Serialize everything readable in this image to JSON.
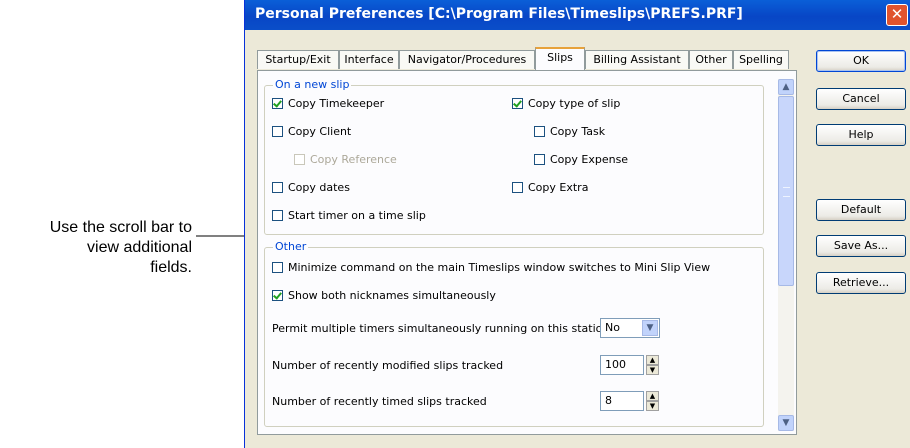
{
  "annotation": {
    "lines": [
      "Use the scroll bar to",
      "view additional",
      "fields."
    ]
  },
  "window": {
    "title": "Personal Preferences [C:\\Program Files\\Timeslips\\PREFS.PRF]",
    "close_glyph": "✕"
  },
  "tabs": [
    {
      "label": "Startup/Exit",
      "active": false
    },
    {
      "label": "Interface",
      "active": false
    },
    {
      "label": "Navigator/Procedures",
      "active": false
    },
    {
      "label": "Slips",
      "active": true
    },
    {
      "label": "Billing Assistant",
      "active": false
    },
    {
      "label": "Other",
      "active": false
    },
    {
      "label": "Spelling",
      "active": false
    }
  ],
  "new_slip_group": {
    "label": "On a new slip",
    "copy_timekeeper": {
      "label": "Copy Timekeeper",
      "checked": true
    },
    "copy_client": {
      "label": "Copy Client",
      "checked": false
    },
    "copy_reference": {
      "label": "Copy Reference",
      "checked": false,
      "enabled": false
    },
    "copy_dates": {
      "label": "Copy dates",
      "checked": false
    },
    "start_timer": {
      "label": "Start timer on a time slip",
      "checked": false
    },
    "copy_type_of_slip": {
      "label": "Copy type of slip",
      "checked": true
    },
    "copy_task": {
      "label": "Copy Task",
      "checked": false
    },
    "copy_expense": {
      "label": "Copy Expense",
      "checked": false
    },
    "copy_extra": {
      "label": "Copy Extra",
      "checked": false
    }
  },
  "other_group": {
    "label": "Other",
    "minimize": {
      "label": "Minimize command on the main Timeslips window switches to Mini Slip View",
      "checked": false
    },
    "show_nicknames": {
      "label": "Show both nicknames simultaneously",
      "checked": true
    },
    "permit_timers": {
      "label": "Permit multiple timers simultaneously running on this station",
      "value": "No"
    },
    "recent_modified": {
      "label": "Number of recently modified slips tracked",
      "value": "100"
    },
    "recent_timed": {
      "label": "Number of recently timed slips tracked",
      "value": "8"
    }
  },
  "buttons": {
    "ok": "OK",
    "cancel": "Cancel",
    "help": "Help",
    "default": "Default",
    "save_as": "Save As...",
    "retrieve": "Retrieve..."
  },
  "icons": {
    "scroll_up": "▲",
    "scroll_down": "▼",
    "dropdown": "▼",
    "spin_up": "▲",
    "spin_down": "▼"
  },
  "colors": {
    "titlebar": "#0846c6",
    "group_label": "#0046d5",
    "checkmark": "#21a121",
    "close_button": "#e0532e"
  }
}
